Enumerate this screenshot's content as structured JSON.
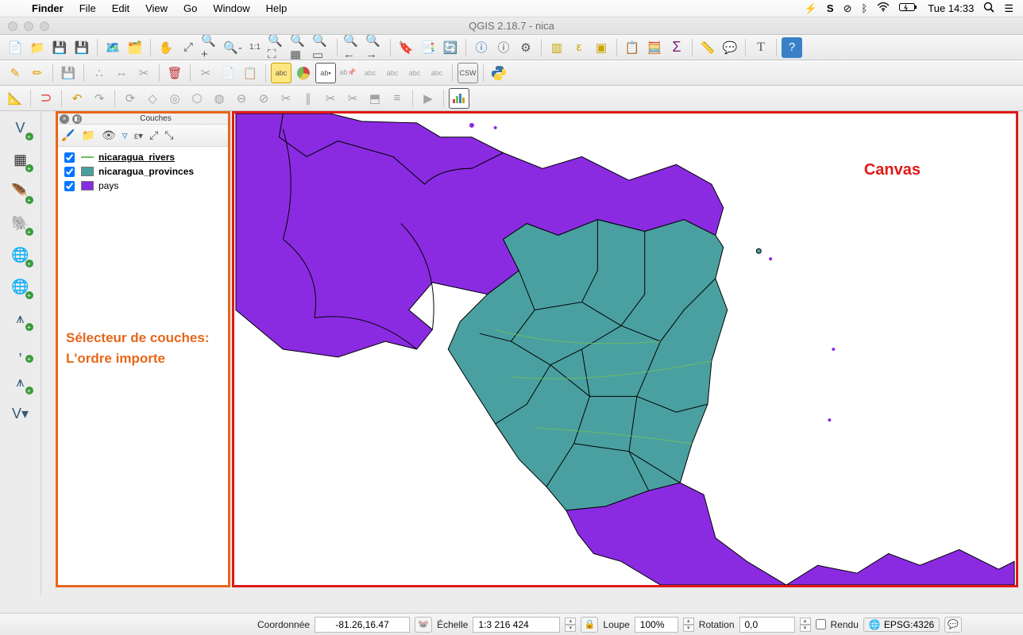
{
  "mac_menu": {
    "app": "Finder",
    "items": [
      "File",
      "Edit",
      "View",
      "Go",
      "Window",
      "Help"
    ],
    "right": {
      "clock": "Tue  14:33"
    }
  },
  "window": {
    "title": "QGIS 2.18.7 - nica"
  },
  "layers_panel": {
    "title": "Couches",
    "items": [
      {
        "name": "nicaragua_rivers",
        "type": "line",
        "color": "#6fbf5e",
        "checked": true,
        "bold": true,
        "underline": true
      },
      {
        "name": "nicaragua_provinces",
        "type": "fill",
        "color": "#4aa0a0",
        "checked": true,
        "bold": true
      },
      {
        "name": "pays",
        "type": "fill",
        "color": "#8a2be2",
        "checked": true,
        "bold": false
      }
    ],
    "annotation": "Sélecteur de couches:\nL'ordre importe"
  },
  "canvas": {
    "label": "Canvas",
    "colors": {
      "countries": "#8a2be2",
      "provinces": "#4aa0a0",
      "river": "#6fbf5e",
      "border": "#000"
    }
  },
  "statusbar": {
    "coord_label": "Coordonnée",
    "coord_value": "-81.26,16.47",
    "scale_label": "Échelle",
    "scale_value": "1:3 216 424",
    "loupe_label": "Loupe",
    "loupe_value": "100%",
    "rotation_label": "Rotation",
    "rotation_value": "0,0",
    "render_label": "Rendu",
    "epsg": "EPSG:4326"
  }
}
